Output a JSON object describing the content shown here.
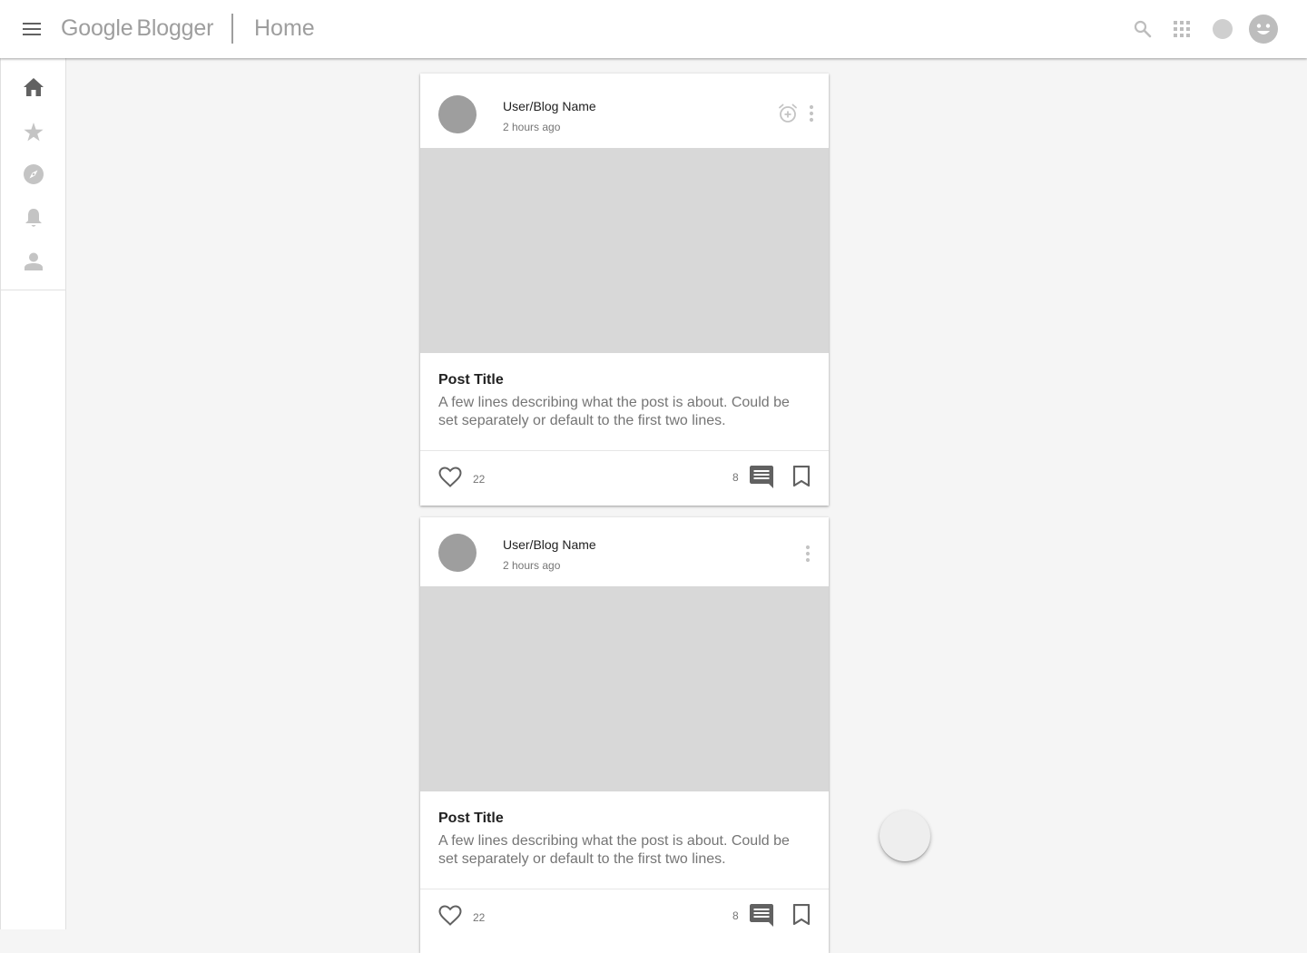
{
  "appbar": {
    "brand": "Google",
    "product": "Blogger",
    "page_title": "Home",
    "icons": [
      "menu-icon",
      "search-icon",
      "apps-icon",
      "account-icon",
      "smiley-avatar-icon"
    ]
  },
  "sidenav": {
    "items": [
      {
        "icon": "home-icon",
        "active": true
      },
      {
        "icon": "star-icon",
        "active": false
      },
      {
        "icon": "compass-icon",
        "active": false
      },
      {
        "icon": "bell-icon",
        "active": false
      },
      {
        "icon": "person-icon",
        "active": false
      }
    ]
  },
  "posts": [
    {
      "author": "User/Blog Name",
      "time": "2 hours ago",
      "title": "Post Title",
      "excerpt": "A few lines describing what the post is about. Could be set separately or default to the first two lines.",
      "likes": "22",
      "comments": "8"
    },
    {
      "author": "User/Blog Name",
      "time": "2 hours ago",
      "title": "Post Title",
      "excerpt": "A few lines describing what the post is about. Could be set separately or default to the first two lines.",
      "likes": "22",
      "comments": "8"
    }
  ],
  "colors": {
    "icon_active": "#616161",
    "icon_inactive": "#c4c4c4",
    "image_placeholder": "#d8d8d8",
    "avatar_placeholder": "#9e9e9e"
  }
}
